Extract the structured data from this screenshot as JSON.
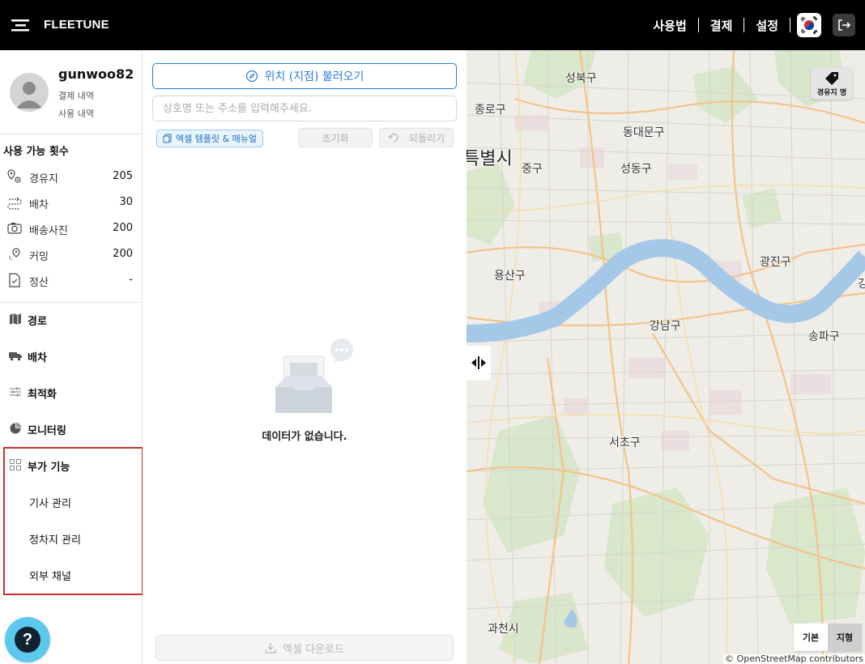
{
  "topbar": {
    "brand": "FLEETUNE",
    "nav": [
      "사용법",
      "결제",
      "설정"
    ]
  },
  "profile": {
    "username": "gunwoo82",
    "links": [
      "결제 내역",
      "사용 내역"
    ]
  },
  "usage": {
    "title": "사용 가능 횟수",
    "items": [
      {
        "label": "경유지",
        "value": "205",
        "icon": "waypoint-icon"
      },
      {
        "label": "배차",
        "value": "30",
        "icon": "dispatch-icon"
      },
      {
        "label": "배송사진",
        "value": "200",
        "icon": "camera-icon"
      },
      {
        "label": "커밍",
        "value": "200",
        "icon": "location-pin-icon"
      },
      {
        "label": "정산",
        "value": "-",
        "icon": "settlement-icon"
      }
    ]
  },
  "nav": {
    "items": [
      {
        "label": "경로",
        "icon": "map-icon"
      },
      {
        "label": "배차",
        "icon": "truck-icon"
      },
      {
        "label": "최적화",
        "icon": "sliders-icon"
      },
      {
        "label": "모니터링",
        "icon": "pie-chart-icon"
      },
      {
        "label": "부가 기능",
        "icon": "grid-icon"
      }
    ],
    "sub_items": [
      "기사 관리",
      "정차지 관리",
      "외부 채널"
    ]
  },
  "help": {
    "label": "?"
  },
  "panel": {
    "load_button": "위치 (지점) 불러오기",
    "search_placeholder": "상호명 또는 주소를 입력해주세요.",
    "excel_template": "엑셀 템플릿 & 매뉴얼",
    "reset": "초기화",
    "undo": "되돌리기",
    "empty_text": "데이터가 없습니다.",
    "download": "엑셀 다운로드"
  },
  "map": {
    "labels": [
      "성북구",
      "종로구",
      "동대문구",
      "특별시",
      "중구",
      "성동구",
      "광진구",
      "용산구",
      "강남구",
      "송파구",
      "서초구",
      "과천시",
      "강"
    ],
    "waypoint_button": "경유지 명",
    "map_types": [
      "기본",
      "지형"
    ],
    "attribution": "© OpenStreetMap contributors"
  },
  "colors": {
    "topbar": "#000000",
    "accent": "#2b7bd4",
    "highlight": "#c9302c",
    "help": "#5cc8ec",
    "river": "#a5c8e8"
  }
}
